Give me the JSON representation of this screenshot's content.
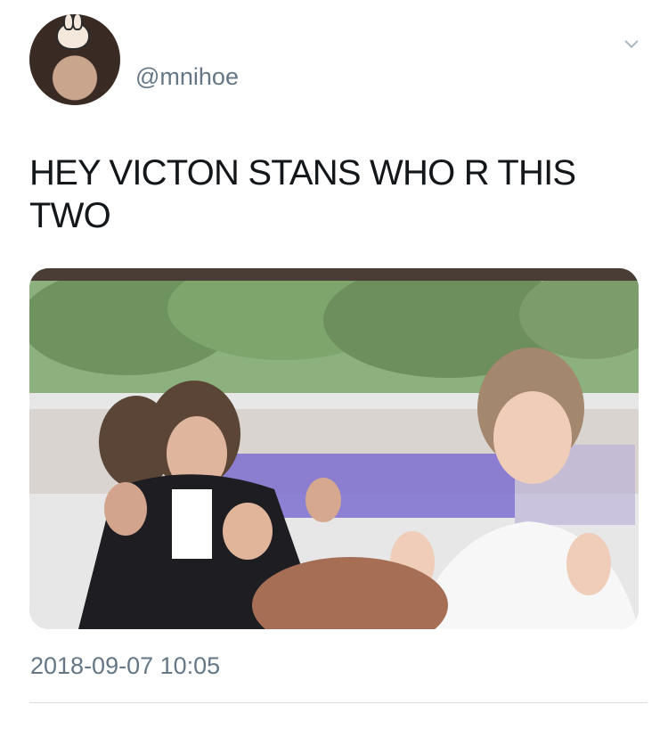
{
  "tweet": {
    "author": {
      "handle": "@mnihoe",
      "avatar_icon": "user-avatar"
    },
    "menu_icon": "chevron-down-icon",
    "text": "HEY VICTON STANS WHO R THIS\nTWO",
    "media": {
      "type": "photo"
    },
    "timestamp": "2018-09-07 10:05"
  },
  "colors": {
    "text_primary": "#14171a",
    "text_secondary": "#657786",
    "divider": "#d5dce1",
    "background": "#ffffff"
  }
}
